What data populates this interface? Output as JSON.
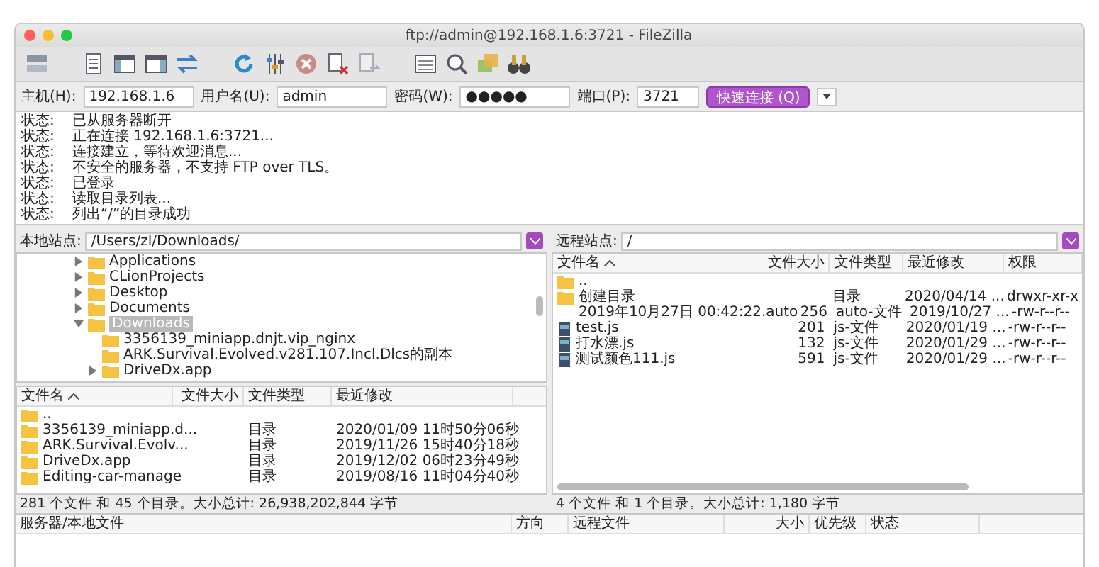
{
  "window": {
    "title": "ftp://admin@192.168.1.6:3721 - FileZilla"
  },
  "quickconnect": {
    "fields": [
      {
        "label": "主机(H):",
        "value": "192.168.1.6",
        "kind": "text"
      },
      {
        "label": "用户名(U):",
        "value": "admin",
        "kind": "text"
      },
      {
        "label": "密码(W):",
        "value": "●●●●●",
        "kind": "password"
      },
      {
        "label": "端口(P):",
        "value": "3721",
        "kind": "port"
      }
    ],
    "button": "快速连接 (Q)"
  },
  "log": [
    {
      "label": "状态:",
      "message": "已从服务器断开"
    },
    {
      "label": "状态:",
      "message": "正在连接 192.168.1.6:3721..."
    },
    {
      "label": "状态:",
      "message": "连接建立，等待欢迎消息..."
    },
    {
      "label": "状态:",
      "message": "不安全的服务器，不支持 FTP over TLS。"
    },
    {
      "label": "状态:",
      "message": "已登录"
    },
    {
      "label": "状态:",
      "message": "读取目录列表..."
    },
    {
      "label": "状态:",
      "message": "列出“/”的目录成功"
    }
  ],
  "local": {
    "site_label": "本地站点:",
    "path": "/Users/zl/Downloads/",
    "tree": [
      {
        "name": "Applications",
        "expanded": false,
        "selected": false
      },
      {
        "name": "CLionProjects",
        "expanded": false,
        "selected": false
      },
      {
        "name": "Desktop",
        "expanded": false,
        "selected": false
      },
      {
        "name": "Documents",
        "expanded": false,
        "selected": false
      },
      {
        "name": "Downloads",
        "expanded": true,
        "selected": true,
        "children": [
          {
            "name": "3356139_miniapp.dnjt.vip_nginx",
            "selected": false
          },
          {
            "name": "ARK.Survival.Evolved.v281.107.Incl.Dlcs的副本",
            "selected": false
          },
          {
            "name": "DriveDx.app",
            "expanded": false,
            "selected": false
          }
        ]
      }
    ],
    "columns": [
      "文件名",
      "文件大小",
      "文件类型",
      "最近修改"
    ],
    "rows": [
      {
        "kind": "folder",
        "name": ".."
      },
      {
        "kind": "folder",
        "name": "3356139_miniapp.d...",
        "type": "目录",
        "modified": "2020/01/09 11时50分06秒"
      },
      {
        "kind": "folder",
        "name": "ARK.Survival.Evolv...",
        "type": "目录",
        "modified": "2019/11/26 15时40分18秒"
      },
      {
        "kind": "folder",
        "name": "DriveDx.app",
        "type": "目录",
        "modified": "2019/12/02 06时23分49秒"
      },
      {
        "kind": "folder",
        "name": "Editing-car-manage",
        "type": "目录",
        "modified": "2019/08/16 11时04分40秒"
      }
    ],
    "status": "281 个文件 和 45 个目录。大小总计: 26,938,202,844 字节"
  },
  "remote": {
    "site_label": "远程站点:",
    "path": "/",
    "columns": [
      "文件名",
      "文件大小",
      "文件类型",
      "最近修改",
      "权限"
    ],
    "rows": [
      {
        "kind": "folder",
        "name": ".."
      },
      {
        "kind": "folder",
        "name": "创建目录",
        "type": "目录",
        "modified": "2020/04/14 ...",
        "permissions": "drwxr-xr-x"
      },
      {
        "kind": "plain",
        "name": "2019年10月27日 00:42:22.auto",
        "size": "256",
        "type": "auto-文件",
        "modified": "2019/10/27 ...",
        "permissions": "-rw-r--r--"
      },
      {
        "kind": "script",
        "name": "test.js",
        "size": "201",
        "type": "js-文件",
        "modified": "2020/01/19 ...",
        "permissions": "-rw-r--r--"
      },
      {
        "kind": "script",
        "name": "打水漂.js",
        "size": "132",
        "type": "js-文件",
        "modified": "2020/01/29 ...",
        "permissions": "-rw-r--r--"
      },
      {
        "kind": "script",
        "name": "测试颜色111.js",
        "size": "591",
        "type": "js-文件",
        "modified": "2020/01/29 ...",
        "permissions": "-rw-r--r--"
      }
    ],
    "status": "4 个文件 和 1 个目录。大小总计: 1,180 字节"
  },
  "queue": {
    "columns": [
      "服务器/本地文件",
      "方向",
      "远程文件",
      "大小",
      "优先级",
      "状态"
    ]
  }
}
